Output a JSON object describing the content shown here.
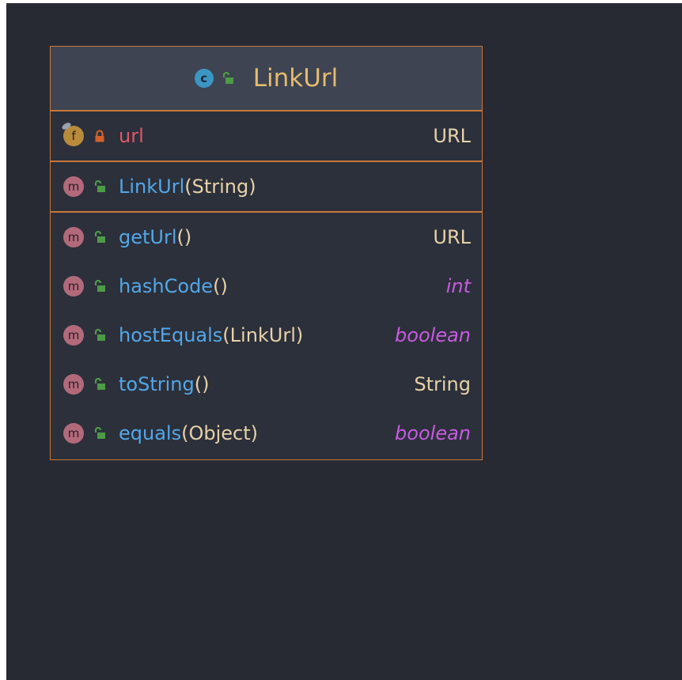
{
  "class": {
    "name": "LinkUrl",
    "kind_letter": "c"
  },
  "fields": [
    {
      "kind": "f",
      "name": "url",
      "type": "URL",
      "visibility": "private"
    }
  ],
  "constructors": [
    {
      "kind": "m",
      "name": "LinkUrl",
      "params": "(String)",
      "type": "",
      "visibility": "public"
    }
  ],
  "methods": [
    {
      "kind": "m",
      "name": "getUrl",
      "params": "()",
      "type": "URL",
      "visibility": "public",
      "primitive": false
    },
    {
      "kind": "m",
      "name": "hashCode",
      "params": "()",
      "type": "int",
      "visibility": "public",
      "primitive": true
    },
    {
      "kind": "m",
      "name": "hostEquals",
      "params": "(LinkUrl)",
      "type": "boolean",
      "visibility": "public",
      "primitive": true
    },
    {
      "kind": "m",
      "name": "toString",
      "params": "()",
      "type": "String",
      "visibility": "public",
      "primitive": false
    },
    {
      "kind": "m",
      "name": "equals",
      "params": "(Object)",
      "type": "boolean",
      "visibility": "public",
      "primitive": true
    }
  ],
  "colors": {
    "background": "#272a33",
    "border": "#c8773a",
    "class_name": "#e5bc6d",
    "method_name": "#53a7e8",
    "field_name": "#e0586a",
    "primitive_type": "#c85be0",
    "type": "#e6d2a8",
    "public_lock": "#4e9a47",
    "private_lock": "#d4612b"
  }
}
